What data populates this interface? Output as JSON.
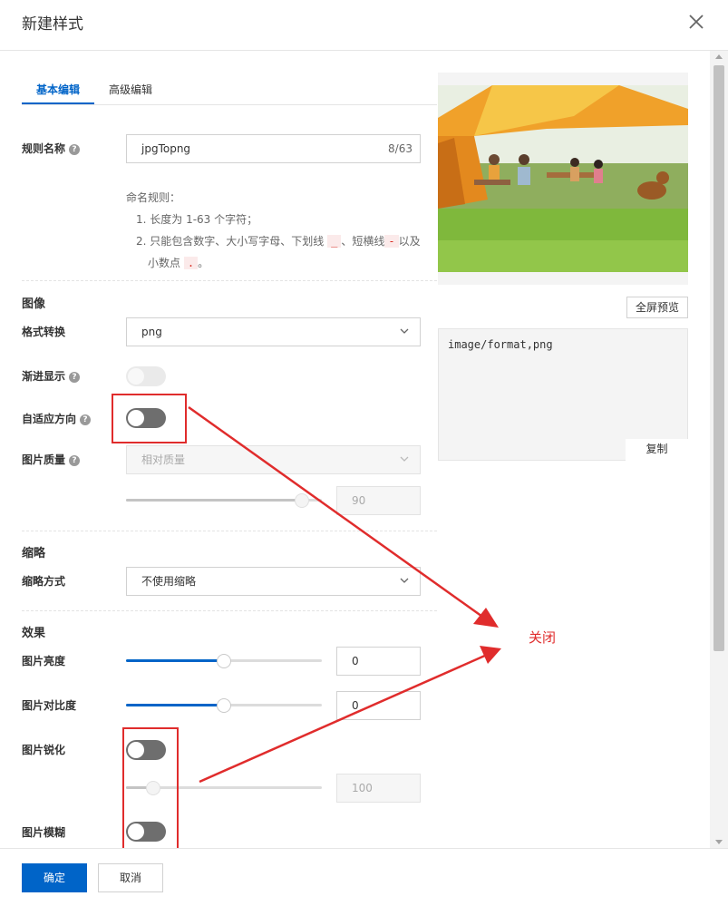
{
  "dialog": {
    "title": "新建样式"
  },
  "tabs": [
    {
      "label": "基本编辑"
    },
    {
      "label": "高级编辑"
    }
  ],
  "rule_name": {
    "label": "规则名称",
    "value": "jpgTopng",
    "count": "8/63",
    "rules_title": "命名规则：",
    "rule_1": "1. 长度为 1-63 个字符；",
    "rule_2_a": "2. 只能包含数字、大小写字母、下划线",
    "rule_2_code_1": "_",
    "rule_2_b": "、短横线",
    "rule_2_code_2": "-",
    "rule_2_c": "以及",
    "rule_2_d": "小数点",
    "rule_2_code_3": ".",
    "rule_2_e": "。"
  },
  "image_section": {
    "title": "图像",
    "format_label": "格式转换",
    "format_value": "png",
    "progressive_label": "渐进显示",
    "auto_orient_label": "自适应方向",
    "quality_label": "图片质量",
    "quality_select": "相对质量",
    "quality_value": "90",
    "quality_level": 0.9
  },
  "thumbnail_section": {
    "title": "缩略",
    "mode_label": "缩略方式",
    "mode_value": "不使用缩略"
  },
  "effects_section": {
    "title": "效果",
    "brightness_label": "图片亮度",
    "brightness_value": "0",
    "contrast_label": "图片对比度",
    "contrast_value": "0",
    "sharpen_label": "图片锐化",
    "sharpen_value": "100",
    "blur_label": "图片模糊"
  },
  "preview": {
    "fullscreen_label": "全屏预览",
    "code_text": "image/format,png",
    "copy_label": "复制"
  },
  "annotation": {
    "text": "关闭"
  },
  "footer": {
    "confirm_label": "确定",
    "cancel_label": "取消"
  },
  "colors": {
    "primary": "#0064c8",
    "annotation_red": "#e02c2c"
  }
}
